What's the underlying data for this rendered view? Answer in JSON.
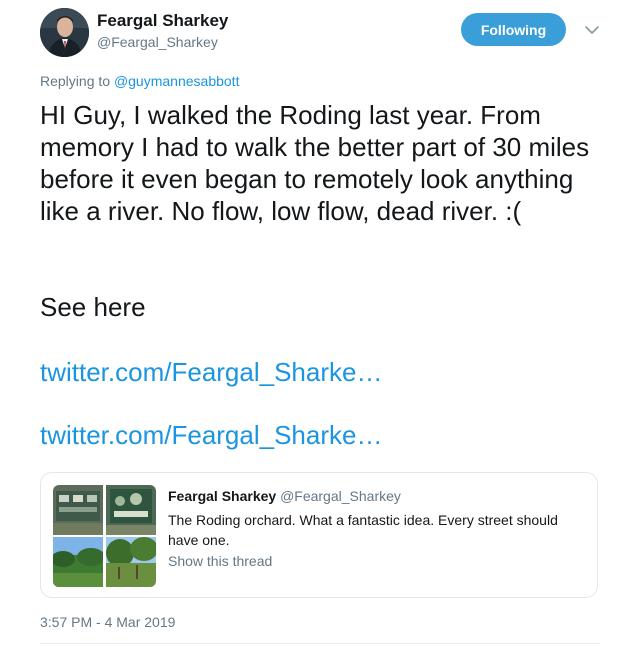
{
  "author": {
    "name": "Feargal Sharkey",
    "handle": "@Feargal_Sharkey",
    "avatar_icon": "profile-photo"
  },
  "follow_button": {
    "label": "Following",
    "color": "#3a9fd8"
  },
  "menu": {
    "icon": "chevron-down-icon"
  },
  "reply": {
    "prefix": "Replying to ",
    "mention": "@guymannesabbott"
  },
  "tweet": {
    "text": "HI Guy, I walked the Roding last year. From memory I had to walk the better part of 30 miles before it even began to remotely look anything like a river. No flow, low flow, dead river. :(",
    "see_here": "See here",
    "links": [
      "twitter.com/Feargal_Sharke…",
      "twitter.com/Feargal_Sharke…"
    ],
    "timestamp": "3:57 PM - 4 Mar 2019"
  },
  "quoted_tweet": {
    "name": "Feargal Sharkey",
    "handle": "@Feargal_Sharkey",
    "text": "The Roding orchard. What a fantastic idea. Every street should have one.",
    "show_thread": "Show this thread"
  },
  "colors": {
    "link": "#1b95e0",
    "secondary_text": "#657786",
    "primary_text": "#14171a",
    "border": "#e1e8ed"
  }
}
